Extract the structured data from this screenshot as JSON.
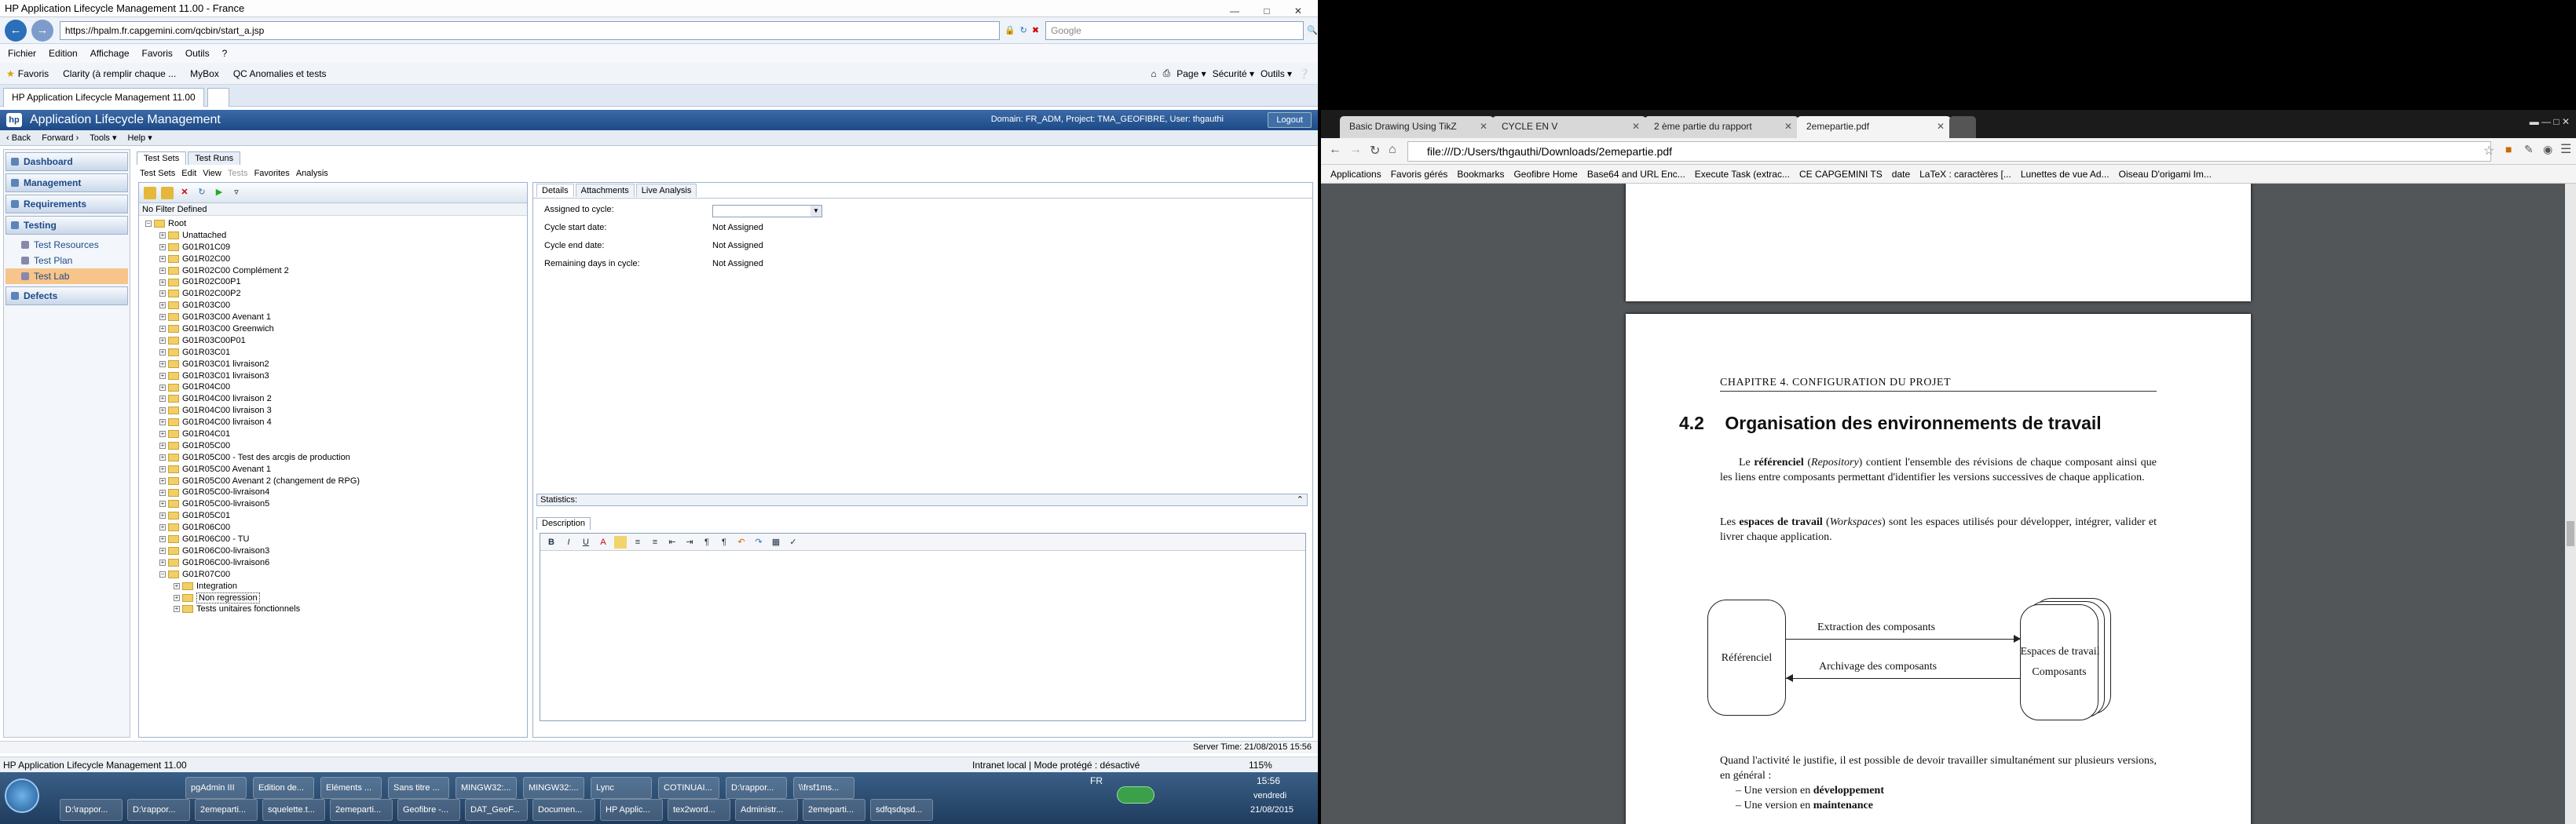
{
  "ie": {
    "title": "HP Application Lifecycle Management 11.00 - France",
    "url": "https://hpalm.fr.capgemini.com/qcbin/start_a.jsp",
    "search_placeholder": "Google",
    "menu": [
      "Fichier",
      "Edition",
      "Affichage",
      "Favoris",
      "Outils",
      "?"
    ],
    "favorites_label": "Favoris",
    "favorites": [
      "Clarity (à remplir chaque ...",
      "MyBox",
      "QC Anomalies et tests"
    ],
    "toolbar_right": [
      "Page ▾",
      "Sécurité ▾",
      "Outils ▾"
    ],
    "tab": "HP Application Lifecycle Management 11.00",
    "status_left": "HP Application Lifecycle Management 11.00",
    "status_zone": "Intranet local | Mode protégé : désactivé",
    "zoom": "115%"
  },
  "alm": {
    "title": "Application Lifecycle Management",
    "logo": "hp",
    "domain_info": "Domain: FR_ADM, Project: TMA_GEOFIBRE, User: thgauthi",
    "logout": "Logout",
    "nav": [
      "‹ Back",
      "Forward ›",
      "Tools ▾",
      "Help ▾"
    ],
    "sidebar": {
      "sections": [
        {
          "label": "Dashboard"
        },
        {
          "label": "Management"
        },
        {
          "label": "Requirements"
        },
        {
          "label": "Testing"
        }
      ],
      "testing_items": [
        "Test Resources",
        "Test Plan",
        "Test Lab"
      ],
      "defects": "Defects"
    },
    "module_tabs": [
      "Test Sets",
      "Test Runs"
    ],
    "module_menu": [
      "Test Sets",
      "Edit",
      "View",
      "Tests",
      "Favorites",
      "Analysis"
    ],
    "filter": "No Filter Defined",
    "tree": [
      {
        "label": "Root",
        "lvl": 0,
        "open": true
      },
      {
        "label": "Unattached",
        "lvl": 1
      },
      {
        "label": "G01R01C09",
        "lvl": 1
      },
      {
        "label": "G01R02C00",
        "lvl": 1
      },
      {
        "label": "G01R02C00 Complément 2",
        "lvl": 1
      },
      {
        "label": "G01R02C00P1",
        "lvl": 1
      },
      {
        "label": "G01R02C00P2",
        "lvl": 1
      },
      {
        "label": "G01R03C00",
        "lvl": 1
      },
      {
        "label": "G01R03C00 Avenant 1",
        "lvl": 1
      },
      {
        "label": "G01R03C00 Greenwich",
        "lvl": 1
      },
      {
        "label": "G01R03C00P01",
        "lvl": 1
      },
      {
        "label": "G01R03C01",
        "lvl": 1
      },
      {
        "label": "G01R03C01 livraison2",
        "lvl": 1
      },
      {
        "label": "G01R03C01 livraison3",
        "lvl": 1
      },
      {
        "label": "G01R04C00",
        "lvl": 1
      },
      {
        "label": "G01R04C00 livraison 2",
        "lvl": 1
      },
      {
        "label": "G01R04C00 livraison 3",
        "lvl": 1
      },
      {
        "label": "G01R04C00 livraison 4",
        "lvl": 1
      },
      {
        "label": "G01R04C01",
        "lvl": 1
      },
      {
        "label": "G01R05C00",
        "lvl": 1
      },
      {
        "label": "G01R05C00 - Test des arcgis de production",
        "lvl": 1
      },
      {
        "label": "G01R05C00 Avenant 1",
        "lvl": 1
      },
      {
        "label": "G01R05C00 Avenant 2 (changement de RPG)",
        "lvl": 1
      },
      {
        "label": "G01R05C00-livraison4",
        "lvl": 1
      },
      {
        "label": "G01R05C00-livraison5",
        "lvl": 1
      },
      {
        "label": "G01R05C01",
        "lvl": 1
      },
      {
        "label": "G01R06C00",
        "lvl": 1
      },
      {
        "label": "G01R06C00 - TU",
        "lvl": 1
      },
      {
        "label": "G01R06C00-livraison3",
        "lvl": 1
      },
      {
        "label": "G01R06C00-livraison6",
        "lvl": 1
      },
      {
        "label": "G01R07C00",
        "lvl": 1,
        "open": true
      },
      {
        "label": "Integration",
        "lvl": 2
      },
      {
        "label": "Non regression",
        "lvl": 2,
        "selected": true
      },
      {
        "label": "Tests unitaires fonctionnels",
        "lvl": 2
      }
    ],
    "details_tabs": [
      "Details",
      "Attachments",
      "Live Analysis"
    ],
    "fields": [
      {
        "label": "Assigned to cycle:",
        "value": ""
      },
      {
        "label": "Cycle start date:",
        "value": "Not Assigned"
      },
      {
        "label": "Cycle end date:",
        "value": "Not Assigned"
      },
      {
        "label": "Remaining days in cycle:",
        "value": "Not Assigned"
      }
    ],
    "statistics": "Statistics:",
    "description": "Description",
    "server_time": "Server Time: 21/08/2015 15:56"
  },
  "taskbar": {
    "row1": [
      "pgAdmin III",
      "Edition de...",
      "Eléments ...",
      "Sans titre ...",
      "MINGW32:...",
      "MINGW32:...",
      "Lync",
      "COTINUAI...",
      "D:\\rappor...",
      "\\\\frsf1ms..."
    ],
    "row2": [
      "D:\\rappor...",
      "D:\\rappor...",
      "2emeparti...",
      "squelette.t...",
      "2emeparti...",
      "Geofibre -...",
      "DAT_GeoF...",
      "Documen...",
      "HP Applic...",
      "tex2word...",
      "Administr...",
      "2emeparti...",
      "sdfqsdqsd..."
    ],
    "lang": "FR",
    "time": "15:56",
    "day": "vendredi",
    "date": "21/08/2015"
  },
  "chrome": {
    "tabs": [
      "Basic Drawing Using TikZ",
      "CYCLE EN V",
      "2 ème partie du rapport",
      "2emepartie.pdf"
    ],
    "url": "file:///D:/Users/thgauthi/Downloads/2emepartie.pdf",
    "bookmarks": [
      "Applications",
      "Favoris gérés",
      "Bookmarks",
      "Geofibre Home",
      "Base64 and URL Enc...",
      "Execute Task (extrac...",
      "CE CAPGEMINI TS",
      "date",
      "LaTeX : caractères [...",
      "Lunettes de vue Ad...",
      "Oiseau D'origami Im..."
    ]
  },
  "pdf": {
    "chapter": "CHAPITRE 4.  CONFIGURATION DU PROJET",
    "section_num": "4.2",
    "section_title": "Organisation des environnements de travail",
    "p1_a": "Le ",
    "p1_b": "référenciel",
    "p1_c": " (",
    "p1_d": "Repository",
    "p1_e": ") contient l'ensemble des révisions de chaque composant ainsi que les liens entre composants permettant d'identifier les versions successives de chaque application.",
    "p2_a": "Les ",
    "p2_b": "espaces de travail",
    "p2_c": " (",
    "p2_d": "Workspaces",
    "p2_e": ") sont les espaces utilisés pour développer, intégrer, valider et livrer chaque application.",
    "diagram": {
      "left_box": "Référenciel",
      "arrow_top": "Extraction des composants",
      "arrow_bottom": "Archivage des composants",
      "right_box_1": "Espaces de travail",
      "right_box_2": "Composants"
    },
    "p3": "Quand l'activité le justifie, il est possible de devoir travailler simultanément sur plusieurs versions, en général :",
    "li1_a": "Une version en ",
    "li1_b": "développement",
    "li2_a": "Une version en ",
    "li2_b": "maintenance"
  },
  "colors": {
    "alm_header": "#1c4a86",
    "test_lab_highlight": "#f7c48a",
    "pdf_bg": "#525659"
  }
}
